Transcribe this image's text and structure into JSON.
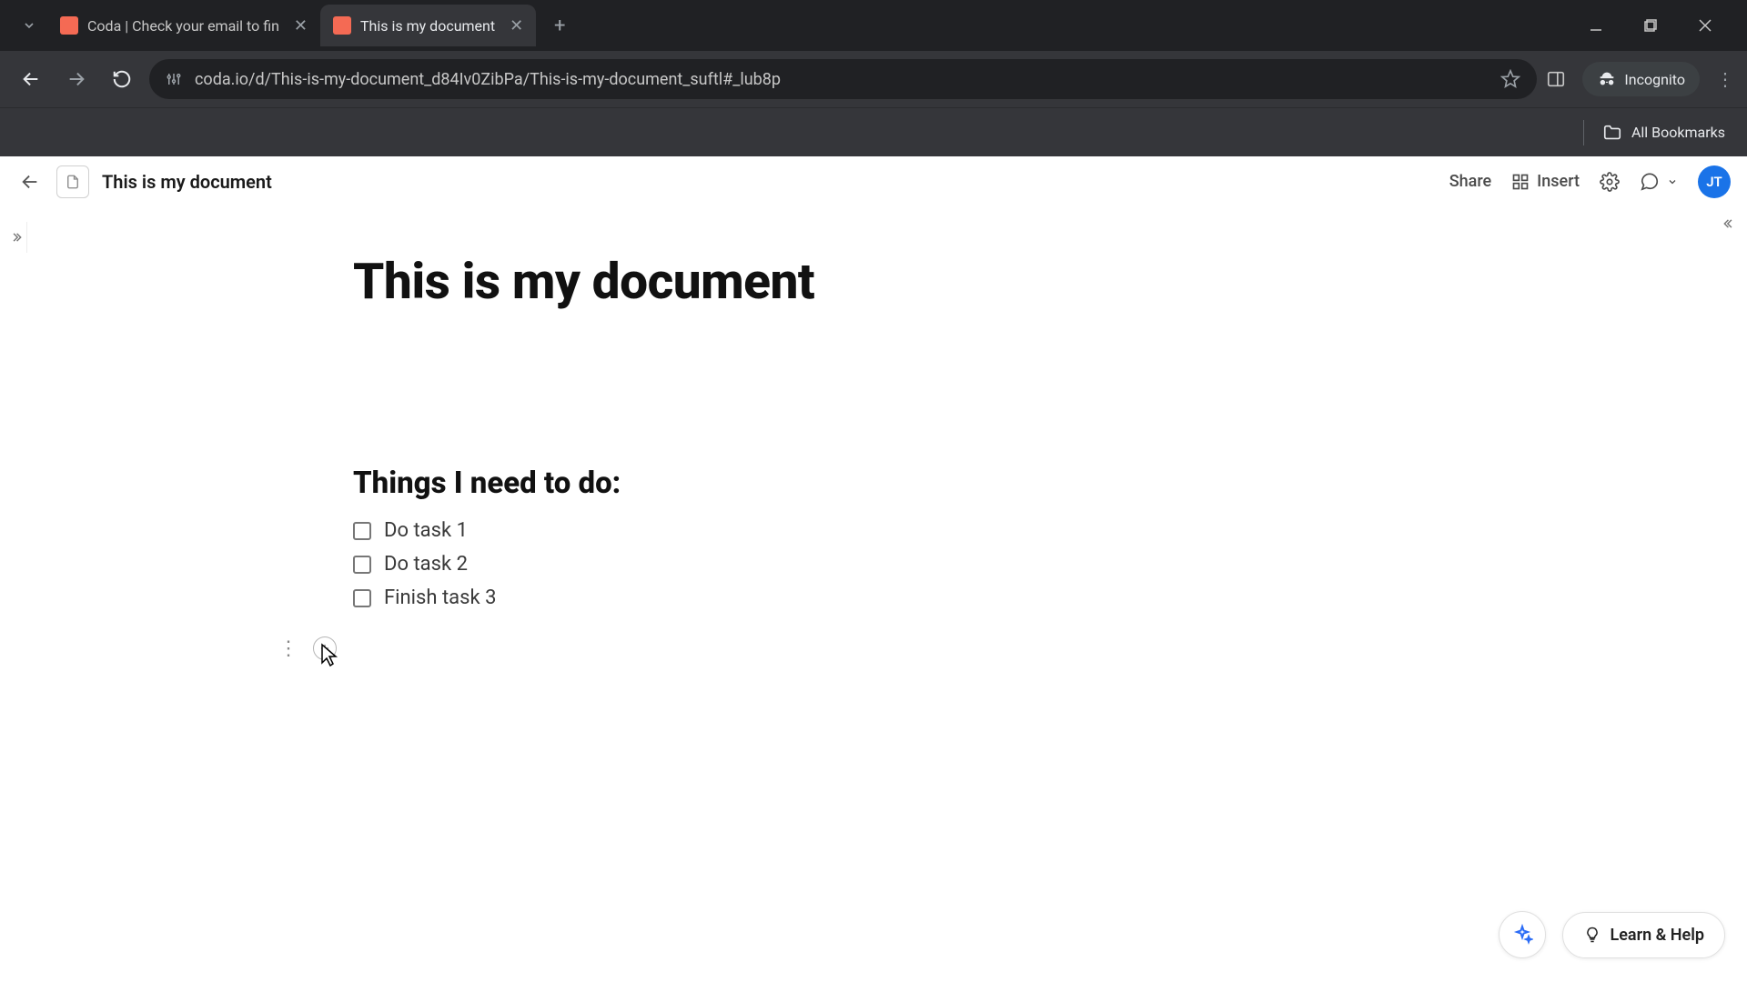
{
  "browser": {
    "tabs": [
      {
        "title": "Coda | Check your email to fin"
      },
      {
        "title": "This is my document"
      }
    ],
    "url": "coda.io/d/This-is-my-document_d84Iv0ZibPa/This-is-my-document_suftl#_lub8p",
    "incognito_label": "Incognito",
    "all_bookmarks_label": "All Bookmarks"
  },
  "header": {
    "doc_name": "This is my document",
    "share_label": "Share",
    "insert_label": "Insert",
    "avatar_initials": "JT"
  },
  "page": {
    "title": "This is my document",
    "section_heading": "Things I need to do:",
    "tasks": [
      {
        "label": "Do task 1",
        "checked": false
      },
      {
        "label": "Do task 2",
        "checked": false
      },
      {
        "label": "Finish task 3",
        "checked": false
      }
    ]
  },
  "footer": {
    "help_label": "Learn & Help"
  }
}
